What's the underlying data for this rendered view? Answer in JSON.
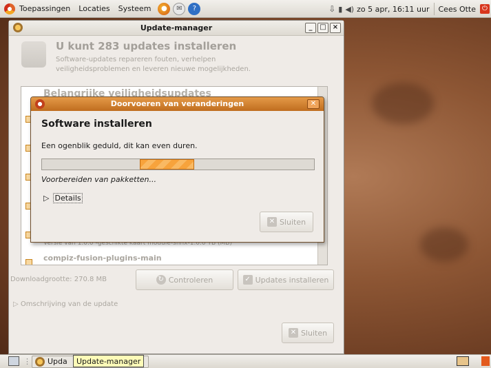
{
  "top_panel": {
    "menus": [
      "Toepassingen",
      "Locaties",
      "Systeem"
    ],
    "launchers": [
      "firefox-icon",
      "mail-icon",
      "help-icon"
    ],
    "clock": "zo  5 apr, 16:11 uur",
    "user": "Cees Otte"
  },
  "main_window": {
    "title": "Update-manager",
    "heading": "U kunt 283 updates installeren",
    "subtitle": "Software-updates repareren fouten, verhelpen veiligheidsproblemen en leveren nieuwe mogelijkheden.",
    "list": {
      "category": "Belangrijke veiligheidsupdates",
      "partial_item": "Versie van 1.0.0 -geschikte kaart module-sfinx-1.0.0 TB (MB)",
      "last_item": "compiz-fusion-plugins-main"
    },
    "download_size": "Downloadgrootte: 270.8 MB",
    "check_button": "Controleren",
    "install_button": "Updates installeren",
    "description_toggle": "Omschrijving van de update",
    "close_button": "Sluiten"
  },
  "dialog": {
    "title": "Doorvoeren van veranderingen",
    "heading": "Software installeren",
    "message": "Een ogenblik geduld, dit kan even duren.",
    "progress_fraction": 0.2,
    "status": "Voorbereiden van pakketten...",
    "details_label": "Details",
    "close_button": "Sluiten"
  },
  "bottom_panel": {
    "task_label": "Upda",
    "tooltip": "Update-manager"
  },
  "colors": {
    "accent_orange": "#e59a48",
    "progress_stripe": "#f7a33c"
  }
}
